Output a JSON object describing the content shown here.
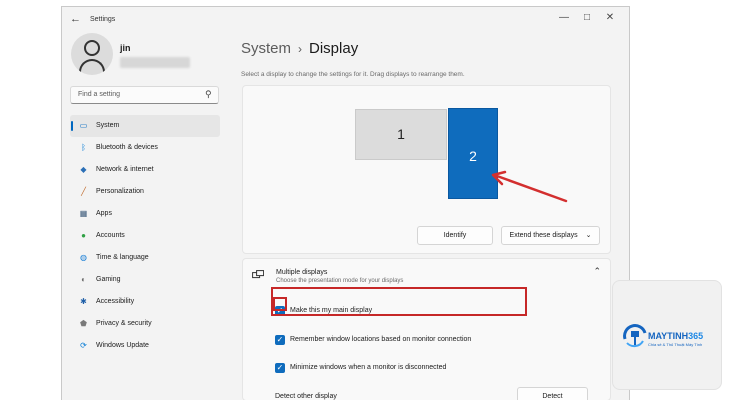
{
  "window": {
    "title": "Settings",
    "controls": [
      "—",
      "□",
      "✕"
    ]
  },
  "profile": {
    "name": "jin"
  },
  "search": {
    "placeholder": "Find a setting"
  },
  "sidebar": {
    "items": [
      {
        "label": "System",
        "icon": "system-icon",
        "color": "#0067c0",
        "active": true
      },
      {
        "label": "Bluetooth & devices",
        "icon": "bluetooth-icon",
        "color": "#0078d4"
      },
      {
        "label": "Network & internet",
        "icon": "wifi-icon",
        "color": "#2b6fb6"
      },
      {
        "label": "Personalization",
        "icon": "brush-icon",
        "color": "#c06a2b"
      },
      {
        "label": "Apps",
        "icon": "apps-icon",
        "color": "#3b5a7a"
      },
      {
        "label": "Accounts",
        "icon": "accounts-icon",
        "color": "#2ea043"
      },
      {
        "label": "Time & language",
        "icon": "globe-icon",
        "color": "#1a7fd6"
      },
      {
        "label": "Gaming",
        "icon": "gaming-icon",
        "color": "#6b6b6b"
      },
      {
        "label": "Accessibility",
        "icon": "accessibility-icon",
        "color": "#1f5fa8"
      },
      {
        "label": "Privacy & security",
        "icon": "shield-icon",
        "color": "#7a7a7a"
      },
      {
        "label": "Windows Update",
        "icon": "update-icon",
        "color": "#0078d4"
      }
    ]
  },
  "header": {
    "parent": "System",
    "separator": "›",
    "current": "Display"
  },
  "arrangement": {
    "hint": "Select a display to change the settings for it. Drag displays to rearrange them.",
    "displays": [
      {
        "number": "1",
        "selected": false
      },
      {
        "number": "2",
        "selected": true
      }
    ],
    "identify_label": "Identify",
    "extend_label": "Extend these displays",
    "extend_chevron": "⌄"
  },
  "multiple_displays": {
    "title": "Multiple displays",
    "subtitle": "Choose the presentation mode for your displays",
    "chevron": "⌃",
    "options": [
      {
        "label": "Make this my main display",
        "checked": true
      },
      {
        "label": "Remember window locations based on monitor connection",
        "checked": true
      },
      {
        "label": "Minimize windows when a monitor is disconnected",
        "checked": true
      }
    ],
    "detect_label": "Detect other display",
    "detect_button": "Detect"
  },
  "watermark": {
    "brand_a": "MAYTINH",
    "brand_b": "365",
    "tagline": "Chia sẻ & Thủ Thuật Máy Tính"
  },
  "colors": {
    "accent": "#0f6cbd",
    "annotation": "#c62828"
  }
}
